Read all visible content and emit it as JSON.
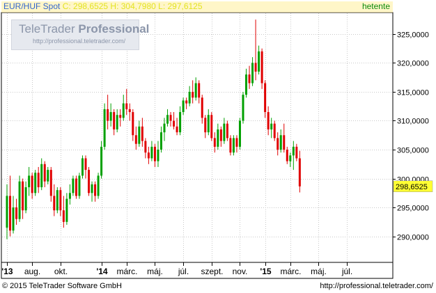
{
  "header": {
    "symbol": "EUR/HUF Spot",
    "ohlc": "C: 298,6525 H: 304,7980 L: 297,6125",
    "period": "hetente"
  },
  "watermark": {
    "brand_a": "TeleTrader",
    "brand_b": "Professional",
    "url": "http://professional.teletrader.com/"
  },
  "footer": {
    "copyright": "© 2015 TeleTrader Software GmbH",
    "url": "http://professional.teletrader.com/"
  },
  "colors": {
    "up": "#00a000",
    "down": "#e00000",
    "grid": "#c8c8c8",
    "last_bg": "#ffff33"
  },
  "chart_data": {
    "type": "candlestick",
    "ylim": [
      285.5,
      328.6
    ],
    "y_ticks": [
      290,
      295,
      300,
      305,
      310,
      315,
      320,
      325
    ],
    "y_tick_labels": [
      "290,0000",
      "295,0000",
      "300,0000",
      "305,0000",
      "310,0000",
      "315,0000",
      "320,0000",
      "325,0000"
    ],
    "x_ticks": [
      {
        "label": "'13",
        "bold": true,
        "i": 0
      },
      {
        "label": "aug.",
        "bold": false,
        "i": 8
      },
      {
        "label": "okt.",
        "bold": false,
        "i": 17
      },
      {
        "label": "'14",
        "bold": true,
        "i": 30
      },
      {
        "label": "márc.",
        "bold": false,
        "i": 38
      },
      {
        "label": "máj.",
        "bold": false,
        "i": 47
      },
      {
        "label": "júl.",
        "bold": false,
        "i": 56
      },
      {
        "label": "szept.",
        "bold": false,
        "i": 65
      },
      {
        "label": "nov.",
        "bold": false,
        "i": 74
      },
      {
        "label": "'15",
        "bold": true,
        "i": 82
      },
      {
        "label": "márc.",
        "bold": false,
        "i": 90
      },
      {
        "label": "máj.",
        "bold": false,
        "i": 99
      },
      {
        "label": "júl.",
        "bold": false,
        "i": 108
      }
    ],
    "last_value": 298.6525,
    "last_label": "298,6525",
    "candles": [
      [
        291.5,
        299.0,
        289.5,
        297.0
      ],
      [
        297.0,
        300.5,
        290.0,
        291.0
      ],
      [
        291.0,
        297.0,
        290.5,
        295.0
      ],
      [
        295.0,
        296.5,
        292.0,
        293.0
      ],
      [
        293.0,
        300.5,
        292.5,
        299.5
      ],
      [
        299.5,
        300.0,
        293.0,
        294.5
      ],
      [
        294.5,
        299.5,
        294.0,
        298.5
      ],
      [
        298.5,
        302.0,
        297.0,
        300.5
      ],
      [
        300.5,
        301.0,
        296.5,
        297.5
      ],
      [
        297.5,
        301.5,
        297.0,
        301.0
      ],
      [
        301.0,
        302.0,
        297.5,
        298.5
      ],
      [
        298.5,
        303.5,
        298.0,
        302.5
      ],
      [
        302.5,
        303.0,
        298.5,
        299.5
      ],
      [
        299.5,
        302.0,
        299.0,
        301.5
      ],
      [
        301.5,
        302.0,
        296.0,
        297.0
      ],
      [
        297.0,
        299.0,
        293.5,
        294.5
      ],
      [
        294.5,
        298.5,
        294.0,
        298.0
      ],
      [
        298.0,
        298.5,
        293.5,
        294.5
      ],
      [
        294.5,
        297.0,
        291.5,
        292.5
      ],
      [
        292.5,
        297.5,
        292.0,
        296.5
      ],
      [
        296.5,
        299.0,
        295.5,
        297.5
      ],
      [
        297.5,
        300.5,
        297.0,
        300.0
      ],
      [
        300.0,
        300.5,
        296.5,
        297.0
      ],
      [
        297.0,
        301.0,
        296.5,
        300.5
      ],
      [
        300.5,
        304.0,
        300.0,
        303.5
      ],
      [
        303.5,
        304.0,
        300.0,
        301.5
      ],
      [
        301.5,
        302.0,
        297.0,
        297.5
      ],
      [
        297.5,
        299.5,
        296.0,
        299.0
      ],
      [
        299.0,
        299.5,
        296.0,
        297.0
      ],
      [
        297.0,
        301.0,
        296.5,
        300.5
      ],
      [
        300.5,
        306.5,
        300.0,
        305.5
      ],
      [
        305.5,
        313.0,
        305.0,
        312.0
      ],
      [
        312.0,
        314.5,
        308.5,
        310.0
      ],
      [
        310.0,
        313.0,
        309.0,
        311.5
      ],
      [
        311.5,
        312.0,
        307.5,
        308.5
      ],
      [
        308.5,
        312.0,
        308.0,
        311.0
      ],
      [
        311.0,
        312.0,
        309.0,
        310.5
      ],
      [
        310.5,
        314.5,
        310.0,
        313.0
      ],
      [
        313.0,
        315.5,
        311.0,
        312.0
      ],
      [
        312.0,
        313.0,
        310.0,
        311.5
      ],
      [
        311.5,
        312.0,
        306.5,
        307.5
      ],
      [
        307.5,
        309.0,
        305.0,
        306.0
      ],
      [
        306.0,
        310.0,
        305.5,
        309.0
      ],
      [
        309.0,
        310.5,
        305.5,
        306.5
      ],
      [
        306.5,
        307.0,
        303.5,
        304.5
      ],
      [
        304.5,
        305.5,
        302.5,
        303.5
      ],
      [
        303.5,
        306.5,
        303.0,
        305.5
      ],
      [
        305.5,
        306.0,
        302.0,
        303.0
      ],
      [
        303.0,
        306.5,
        302.0,
        305.0
      ],
      [
        305.0,
        309.0,
        304.5,
        308.0
      ],
      [
        308.0,
        310.5,
        306.5,
        309.5
      ],
      [
        309.5,
        312.0,
        309.0,
        311.0
      ],
      [
        311.0,
        311.5,
        309.0,
        310.0
      ],
      [
        310.0,
        311.5,
        308.5,
        309.0
      ],
      [
        309.0,
        310.5,
        307.5,
        308.0
      ],
      [
        308.0,
        312.5,
        307.5,
        311.5
      ],
      [
        311.5,
        314.0,
        311.0,
        313.5
      ],
      [
        313.5,
        314.0,
        312.0,
        313.0
      ],
      [
        313.0,
        316.0,
        312.5,
        315.0
      ],
      [
        315.0,
        317.0,
        313.0,
        314.0
      ],
      [
        314.0,
        317.5,
        313.5,
        316.5
      ],
      [
        316.5,
        317.0,
        313.0,
        314.0
      ],
      [
        314.0,
        314.5,
        309.5,
        310.5
      ],
      [
        310.5,
        311.0,
        307.0,
        308.0
      ],
      [
        308.0,
        312.0,
        307.5,
        311.0
      ],
      [
        311.0,
        311.5,
        306.5,
        307.0
      ],
      [
        307.0,
        308.0,
        304.5,
        305.5
      ],
      [
        305.5,
        309.5,
        305.0,
        308.5
      ],
      [
        308.5,
        309.0,
        305.5,
        306.5
      ],
      [
        306.5,
        310.5,
        306.0,
        309.5
      ],
      [
        309.5,
        310.0,
        306.5,
        307.0
      ],
      [
        307.0,
        307.5,
        304.0,
        304.5
      ],
      [
        304.5,
        307.5,
        304.0,
        307.0
      ],
      [
        307.0,
        307.5,
        304.5,
        305.5
      ],
      [
        305.5,
        310.5,
        305.0,
        310.0
      ],
      [
        310.0,
        315.0,
        309.5,
        314.5
      ],
      [
        314.5,
        319.0,
        314.0,
        318.0
      ],
      [
        318.0,
        319.5,
        315.5,
        316.5
      ],
      [
        316.5,
        321.0,
        316.0,
        320.0
      ],
      [
        320.0,
        327.5,
        317.0,
        318.5
      ],
      [
        318.5,
        323.0,
        318.0,
        322.0
      ],
      [
        322.0,
        322.5,
        315.5,
        316.5
      ],
      [
        316.5,
        317.0,
        310.5,
        311.5
      ],
      [
        311.5,
        312.5,
        307.5,
        308.5
      ],
      [
        308.5,
        310.5,
        307.0,
        309.5
      ],
      [
        309.5,
        310.0,
        306.5,
        307.0
      ],
      [
        307.0,
        308.0,
        304.0,
        305.0
      ],
      [
        305.0,
        308.5,
        304.5,
        307.5
      ],
      [
        307.5,
        309.5,
        304.5,
        305.0
      ],
      [
        305.0,
        305.5,
        302.5,
        303.0
      ],
      [
        303.0,
        304.5,
        302.0,
        304.0
      ],
      [
        304.0,
        306.5,
        301.5,
        305.5
      ],
      [
        305.5,
        306.0,
        303.0,
        303.5
      ],
      [
        303.5,
        304.8,
        297.6,
        298.65
      ]
    ]
  }
}
